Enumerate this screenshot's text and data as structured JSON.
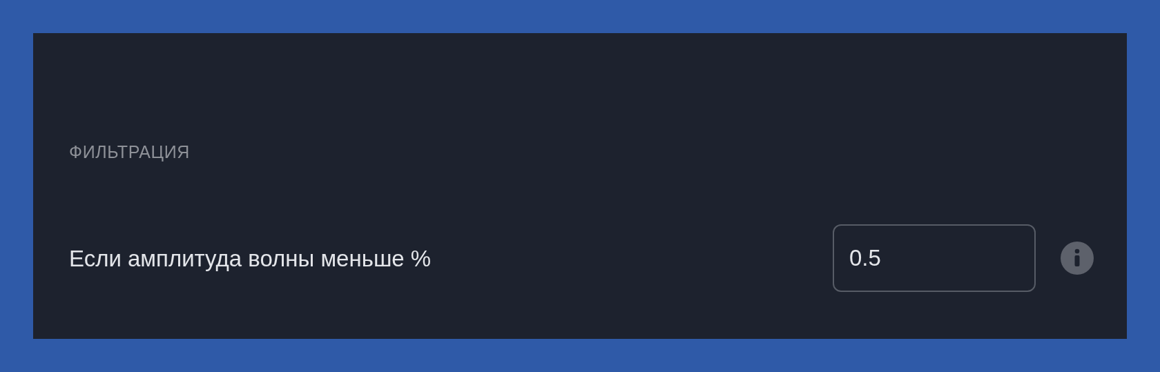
{
  "section": {
    "title": "ФИЛЬТРАЦИЯ"
  },
  "setting": {
    "label": "Если амплитуда волны меньше %",
    "value": "0.5"
  }
}
